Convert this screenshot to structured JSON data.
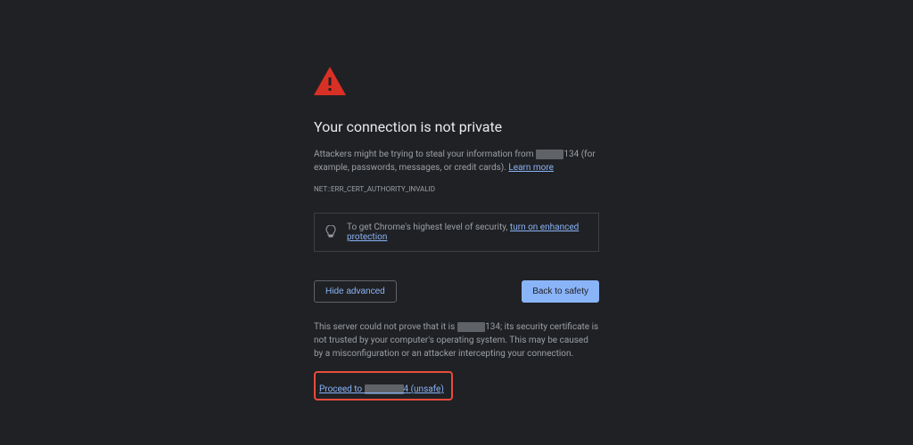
{
  "title": "Your connection is not private",
  "body": {
    "prefix": "Attackers might be trying to steal your information from ",
    "redacted1": "XXXXX",
    "ip_suffix": "134",
    "suffix": " (for example, passwords, messages, or credit cards). "
  },
  "learn_more": "Learn more",
  "error_code": "NET::ERR_CERT_AUTHORITY_INVALID",
  "info_box": {
    "prefix": "To get Chrome's highest level of security, ",
    "link": "turn on enhanced protection"
  },
  "buttons": {
    "hide_advanced": "Hide advanced",
    "back_to_safety": "Back to safety"
  },
  "advanced": {
    "prefix": "This server could not prove that it is ",
    "redacted": "XXXXX",
    "ip_suffix": "134",
    "suffix": "; its security certificate is not trusted by your computer's operating system. This may be caused by a misconfiguration or an attacker intercepting your connection."
  },
  "proceed": {
    "prefix": "Proceed to ",
    "redacted": "XXXXXXX",
    "ip_suffix": "4",
    "suffix": " (unsafe)"
  }
}
